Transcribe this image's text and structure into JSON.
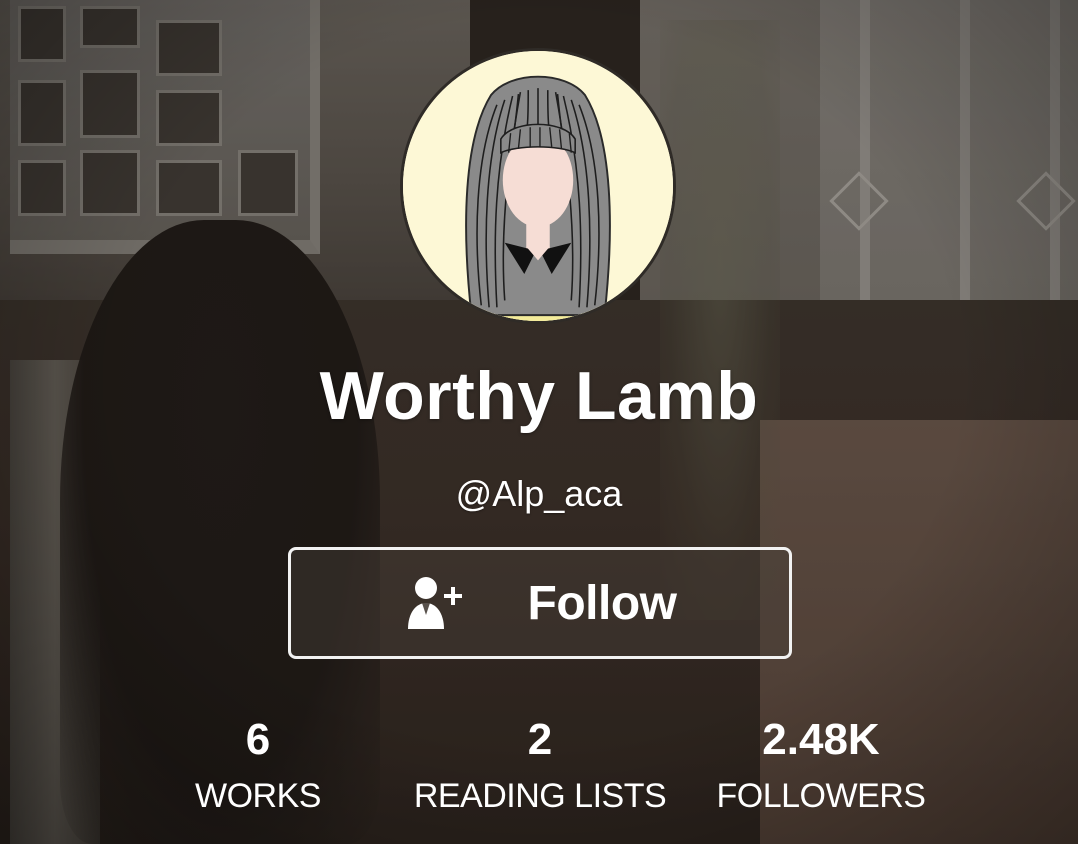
{
  "profile": {
    "display_name": "Worthy Lamb",
    "username": "@Alp_aca",
    "avatar": {
      "icon": "avatar-girl-illustration-icon",
      "background_color": "#fdf8d6"
    }
  },
  "follow_button": {
    "label": "Follow",
    "icon": "add-user-icon"
  },
  "stats": [
    {
      "count": "6",
      "label": "WORKS"
    },
    {
      "count": "2",
      "label": "READING LISTS"
    },
    {
      "count": "2.48K",
      "label": "FOLLOWERS"
    }
  ],
  "colors": {
    "text": "#ffffff",
    "button_border": "#f2f2f2",
    "background_tone": "#3a2f28"
  }
}
